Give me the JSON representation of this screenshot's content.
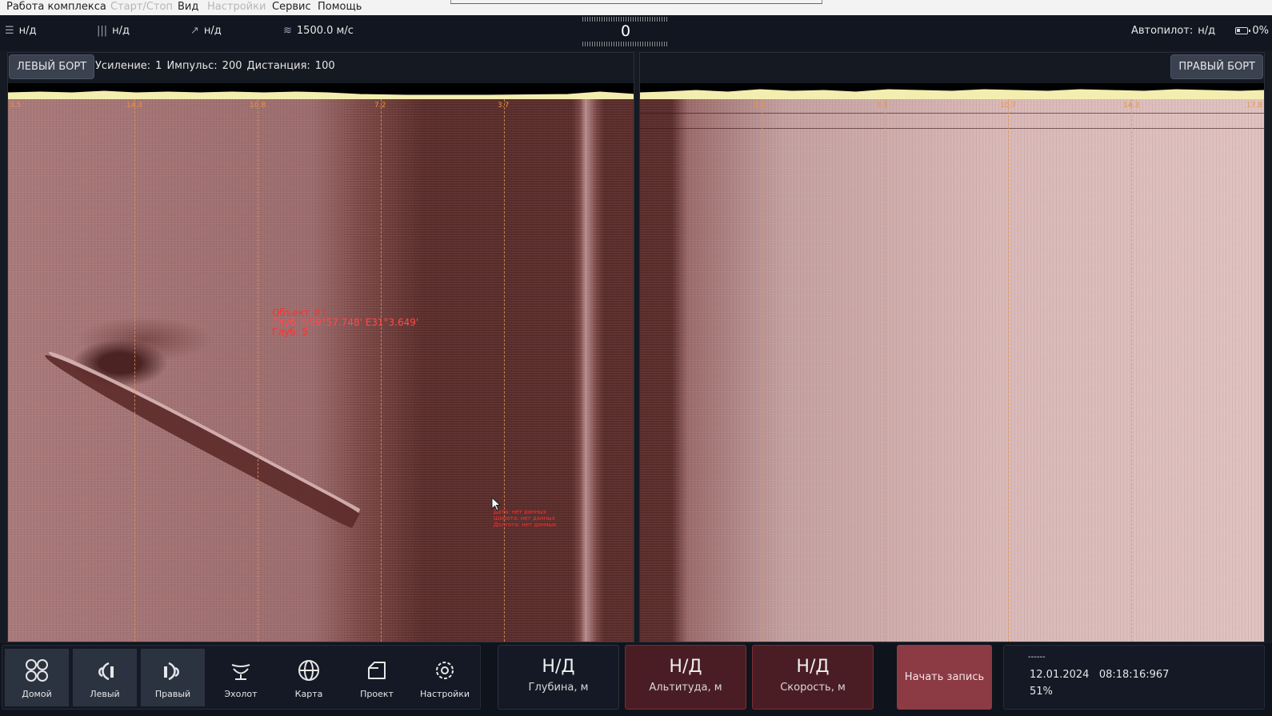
{
  "menu": {
    "items": [
      {
        "label": "Работа комплекса",
        "enabled": true
      },
      {
        "label": "Старт/Стоп",
        "enabled": false
      },
      {
        "label": "Вид",
        "enabled": true
      },
      {
        "label": "Настройки",
        "enabled": false
      },
      {
        "label": "Сервис",
        "enabled": true
      },
      {
        "label": "Помощь",
        "enabled": true
      }
    ]
  },
  "status": {
    "heading": "н/д",
    "pitch": "н/д",
    "roll": "н/д",
    "sound_speed": "1500.0 м/с",
    "compass_value": "0",
    "autopilot_label": "Автопилот:",
    "autopilot_value": "н/д",
    "battery": "0%"
  },
  "left_panel": {
    "side_label": "ЛЕВЫЙ БОРТ",
    "gain_label": "Усиление:",
    "gain_value": "1",
    "pulse_label": "Импульс:",
    "pulse_value": "200",
    "distance_label": "Дистанция:",
    "distance_value": "100",
    "range_ticks": [
      "3.5",
      "14.3",
      "10.8",
      "7.2",
      "3.7"
    ],
    "object": {
      "title": "Объект #1",
      "coords": "Глуб: N59°57.748' E31°3.649'",
      "depth": "Глуб: 5"
    },
    "no_data": {
      "date": "Дата: нет данных",
      "lat": "Широта: нет данных",
      "lon": "Долгота: нет данных"
    }
  },
  "right_panel": {
    "side_label": "ПРАВЫЙ БОРТ",
    "range_ticks": [
      "3.6",
      "7.1",
      "10.7",
      "14.3",
      "17.8"
    ]
  },
  "nav": [
    {
      "label": "Домой",
      "icon": "home-grid-icon",
      "selected": true
    },
    {
      "label": "Левый",
      "icon": "left-sonar-icon",
      "selected": true
    },
    {
      "label": "Правый",
      "icon": "right-sonar-icon",
      "selected": true
    },
    {
      "label": "Эхолот",
      "icon": "echosounder-icon",
      "selected": false
    },
    {
      "label": "Карта",
      "icon": "globe-icon",
      "selected": false
    },
    {
      "label": "Проект",
      "icon": "folder-icon",
      "selected": false
    },
    {
      "label": "Настройки",
      "icon": "gear-icon",
      "selected": false
    }
  ],
  "metrics": [
    {
      "value": "Н/Д",
      "label": "Глубина, м",
      "alert": false
    },
    {
      "value": "Н/Д",
      "label": "Альтитуда, м",
      "alert": true
    },
    {
      "value": "Н/Д",
      "label": "Скорость, м",
      "alert": true
    }
  ],
  "record_button": "Начать запись",
  "info": {
    "dashes": "------",
    "date": "12.01.2024",
    "time": "08:18:16:967",
    "percent": "51%"
  },
  "colors": {
    "accent_range": "#e79545",
    "alert_bg": "#4a1d24",
    "record_bg": "#8c3a44",
    "object_text": "#ff3030"
  }
}
